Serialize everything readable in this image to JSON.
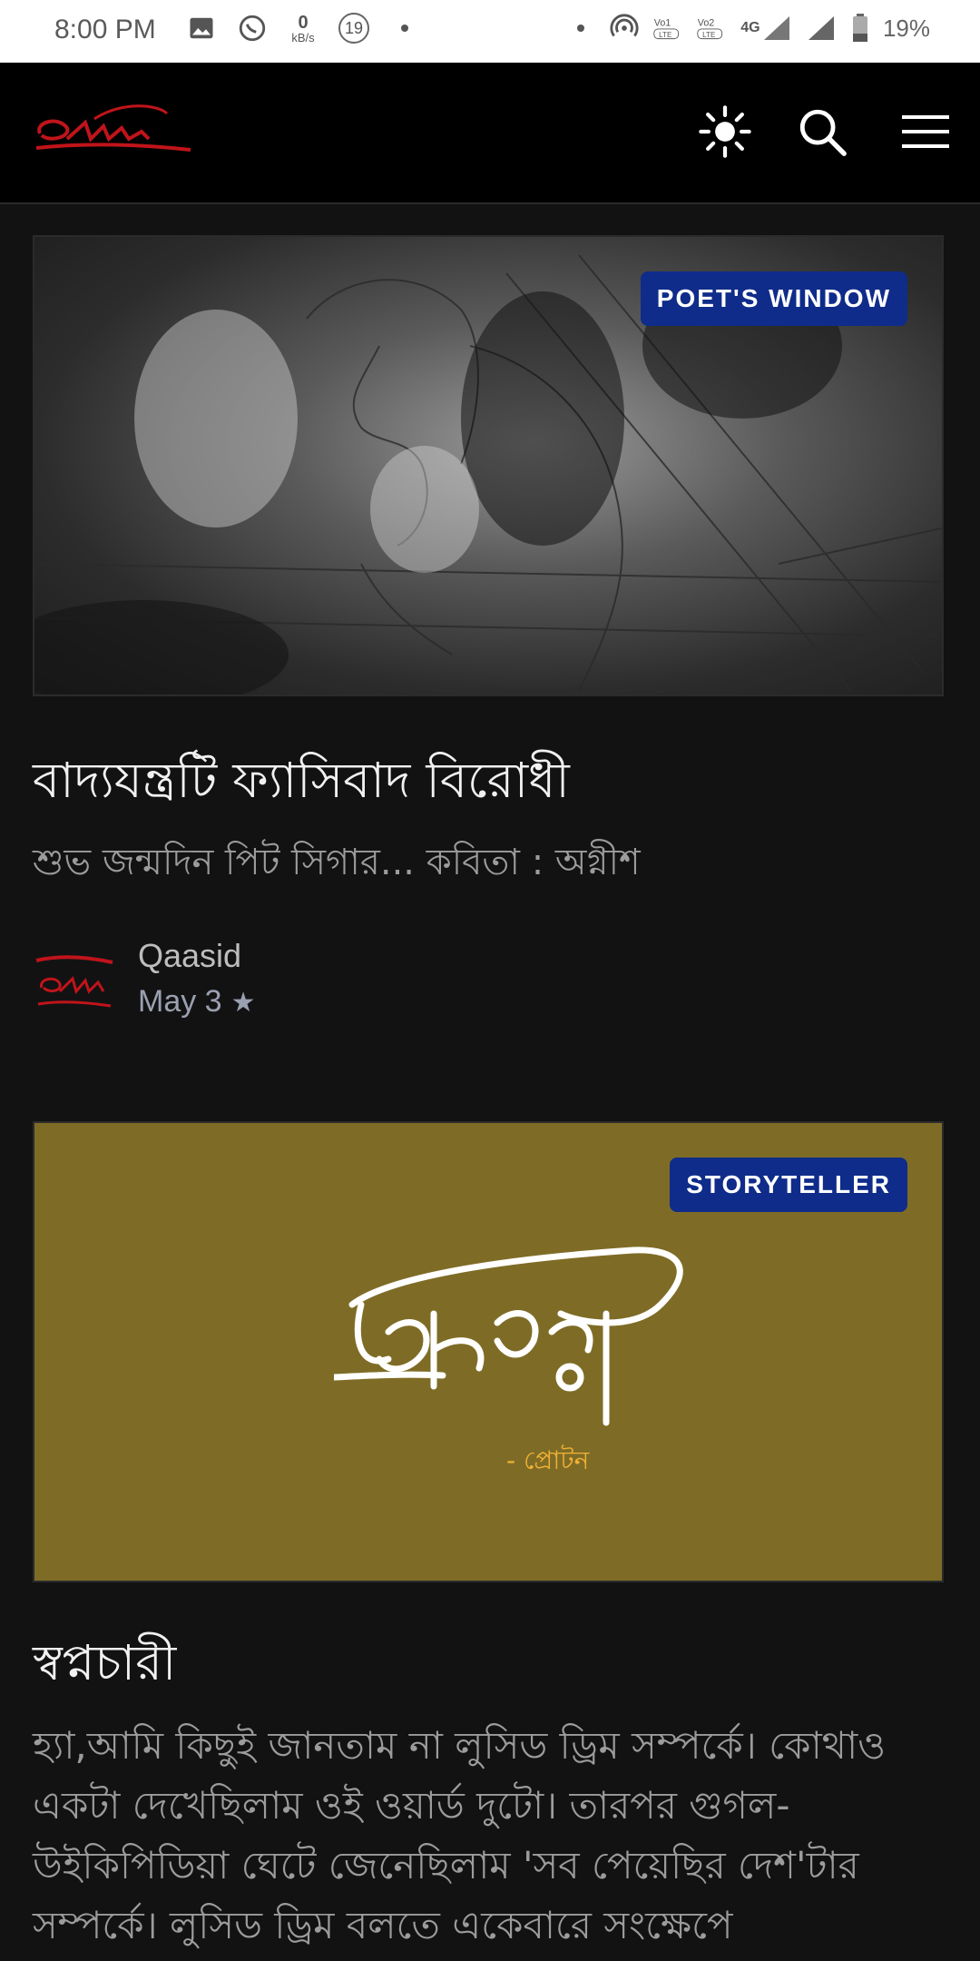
{
  "status_bar": {
    "time": "8:00 PM",
    "data_speed_value": "0",
    "data_speed_unit": "kB/s",
    "notif_count": "19",
    "network": "4G",
    "battery": "19%"
  },
  "header": {
    "logo_text": "Qaasid",
    "icons": [
      "sun-icon",
      "search-icon",
      "menu-icon"
    ]
  },
  "posts": [
    {
      "badge": "POET'S WINDOW",
      "title": "বাদ্যযন্ত্রটি ফ্যাসিবাদ বিরোধী",
      "subtitle": "শুভ জন্মদিন পিট সিগার... কবিতা : অগ্নীশ",
      "author": "Qaasid",
      "date": "May 3"
    },
    {
      "badge": "STORYTELLER",
      "cover_credit": "- প্রোটন",
      "title": "স্বপ্নচারী",
      "excerpt": "হ্যা,আমি কিছুই জানতাম না লুসিড ড্রিম সম্পর্কে। কোথাও একটা দেখেছিলাম ওই ওয়ার্ড দুটো। তারপর গুগল-উইকিপিডিয়া ঘেটে জেনেছিলাম 'সব পেয়েছির দেশ'টার সম্পর্কে। লুসিড ড্রিম বলতে একেবারে সংক্ষেপে"
    }
  ],
  "colors": {
    "background": "#121213",
    "header": "#000000",
    "badge": "#0f2c8a",
    "brand_red": "#c0141a",
    "cover_mustard": "#7e6c26",
    "credit_orange": "#f2b233"
  }
}
